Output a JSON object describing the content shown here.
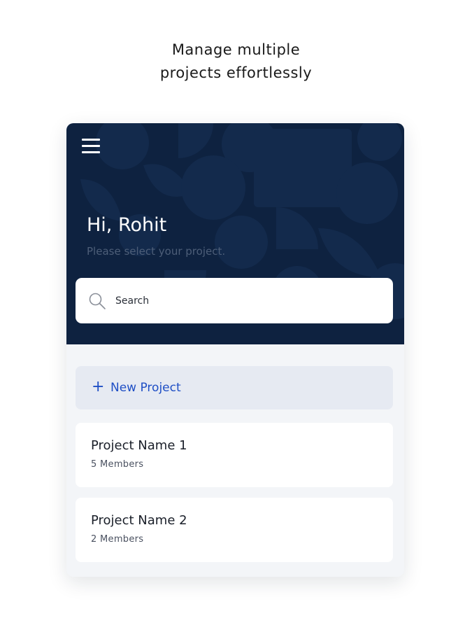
{
  "tagline": {
    "line1": "Manage multiple",
    "line2": "projects effortlessly"
  },
  "header": {
    "menu_icon": "hamburger-menu-icon",
    "greeting": "Hi, Rohit",
    "subtitle": "Please select your project."
  },
  "search": {
    "icon": "search-icon",
    "placeholder": "Search",
    "value": ""
  },
  "new_project": {
    "icon": "plus-icon",
    "plus_glyph": "+",
    "label": "New Project"
  },
  "projects": [
    {
      "name": "Project Name 1",
      "members": "5 Members"
    },
    {
      "name": "Project Name 2",
      "members": "2 Members"
    }
  ],
  "colors": {
    "header_background": "#0e2240",
    "accent_blue": "#1f4fc5",
    "list_background": "#f3f5f8",
    "new_project_background": "#e6eaf2"
  }
}
